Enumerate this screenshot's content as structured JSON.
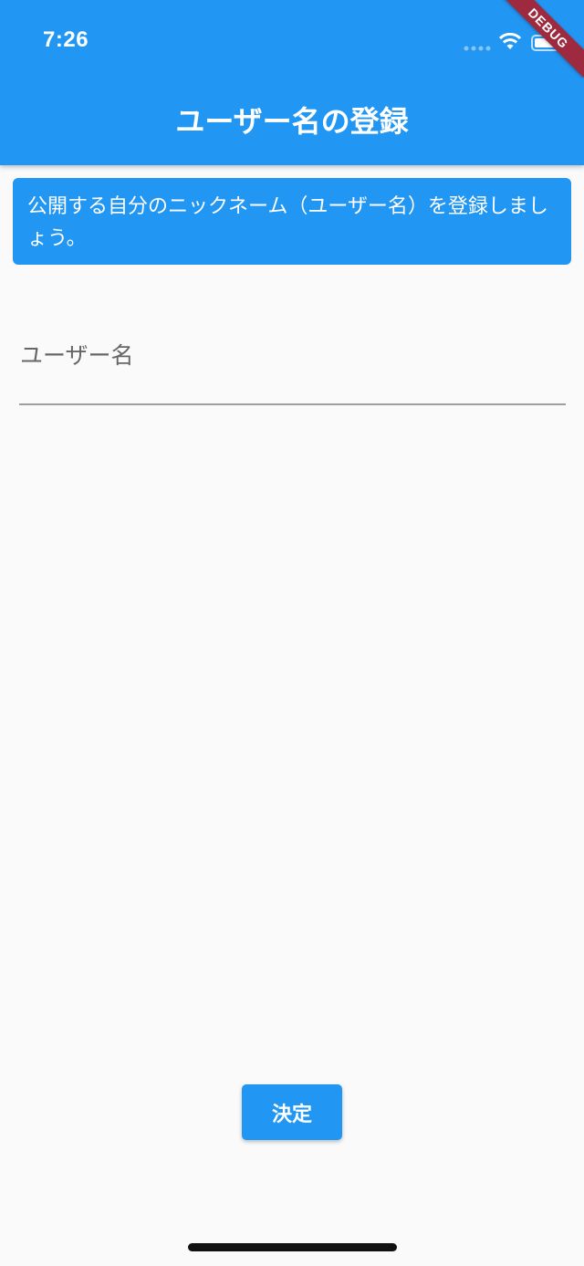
{
  "status_bar": {
    "time": "7:26",
    "icons": [
      "signal-icon",
      "wifi-icon",
      "battery-icon"
    ]
  },
  "debug_banner": "DEBUG",
  "app_bar": {
    "title": "ユーザー名の登録",
    "color": "#2196f3"
  },
  "info_banner": {
    "text": "公開する自分のニックネーム（ユーザー名）を登録しましょう。"
  },
  "form": {
    "username_label": "ユーザー名",
    "username_value": ""
  },
  "submit_button": {
    "label": "決定"
  }
}
